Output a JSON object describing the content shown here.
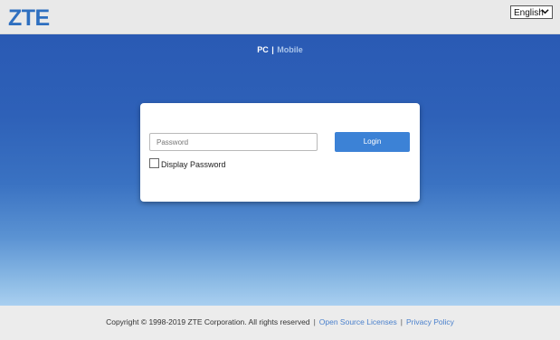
{
  "header": {
    "logo_text": "ZTE",
    "language_selected": "English",
    "language_chevron": "chevron-down-icon"
  },
  "switcher": {
    "pc_label": "PC",
    "separator": "|",
    "mobile_label": "Mobile"
  },
  "login": {
    "password_placeholder": "Password",
    "password_value": "",
    "login_label": "Login",
    "display_password_label": "Display Password",
    "display_password_checked": false
  },
  "footer": {
    "copyright": "Copyright © 1998-2019 ZTE Corporation. All rights reserved",
    "sep1": "|",
    "open_source": "Open Source Licenses",
    "sep2": "|",
    "privacy": "Privacy Policy"
  },
  "colors": {
    "brand": "#2e6fc0",
    "button": "#3c82d6",
    "link": "#4a80cc",
    "hero_top": "#2a5ab4",
    "hero_bottom": "#a9cff0"
  }
}
